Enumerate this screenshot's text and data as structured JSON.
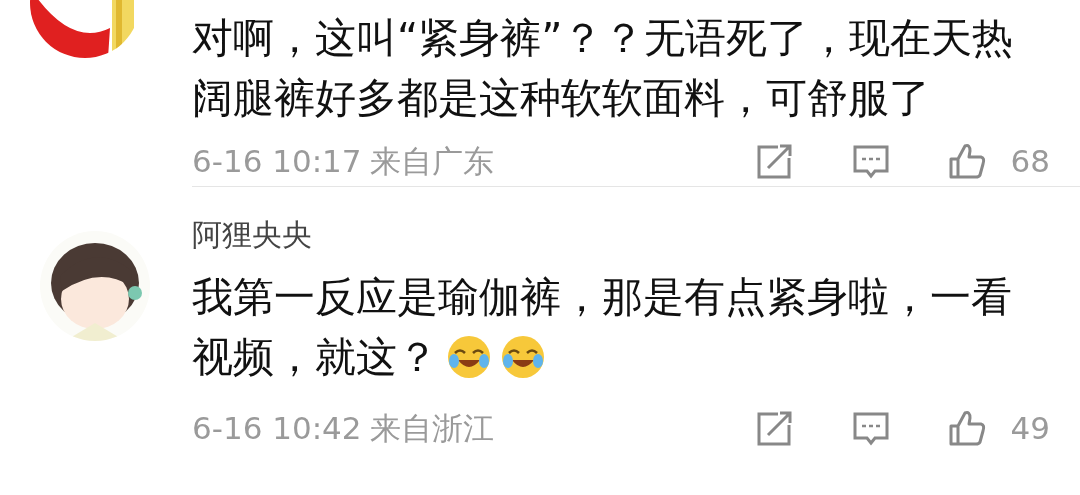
{
  "comments": [
    {
      "lines": [
        "对啊，这叫“紧身裤”？？无语死了，现在天热",
        "阔腿裤好多都是这种软软面料，可舒服了"
      ],
      "date": "6-16 10:17",
      "location": "来自广东",
      "likes": "68"
    },
    {
      "user": "阿狸央央",
      "lines": [
        "我第一反应是瑜伽裤，那是有点紧身啦，一看",
        "视频，就这？"
      ],
      "emojis": [
        {
          "kind": "laughing"
        },
        {
          "kind": "laughing"
        }
      ],
      "date": "6-16 10:42",
      "location": "来自浙江",
      "likes": "49"
    }
  ]
}
